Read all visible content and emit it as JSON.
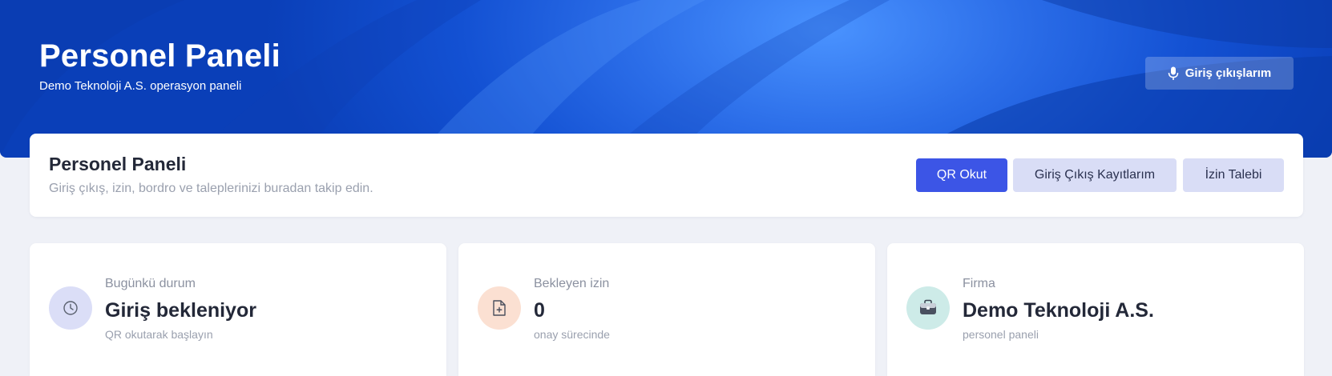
{
  "hero": {
    "title": "Personel Paneli",
    "subtitle": "Demo Teknoloji A.S. operasyon paneli",
    "button_label": "Giriş çıkışlarım",
    "button_icon": "microphone-icon"
  },
  "panel": {
    "title": "Personel Paneli",
    "subtitle": "Giriş çıkış, izin, bordro ve taleplerinizi buradan takip edin.",
    "buttons": {
      "qr": "QR Okut",
      "records": "Giriş Çıkış Kayıtlarım",
      "leave": "İzin Talebi"
    }
  },
  "cards": [
    {
      "label": "Bugünkü durum",
      "value": "Giriş bekleniyor",
      "note": "QR okutarak başlayın",
      "icon": "clock-icon"
    },
    {
      "label": "Bekleyen izin",
      "value": "0",
      "note": "onay sürecinde",
      "icon": "file-plus-icon"
    },
    {
      "label": "Firma",
      "value": "Demo Teknoloji A.S.",
      "note": "personel paneli",
      "icon": "briefcase-icon"
    }
  ],
  "colors": {
    "primary": "#3c55e6",
    "soft_button": "#d9ddf6",
    "hero_blue": "#1351d3",
    "page_bg": "#eff1f7"
  }
}
